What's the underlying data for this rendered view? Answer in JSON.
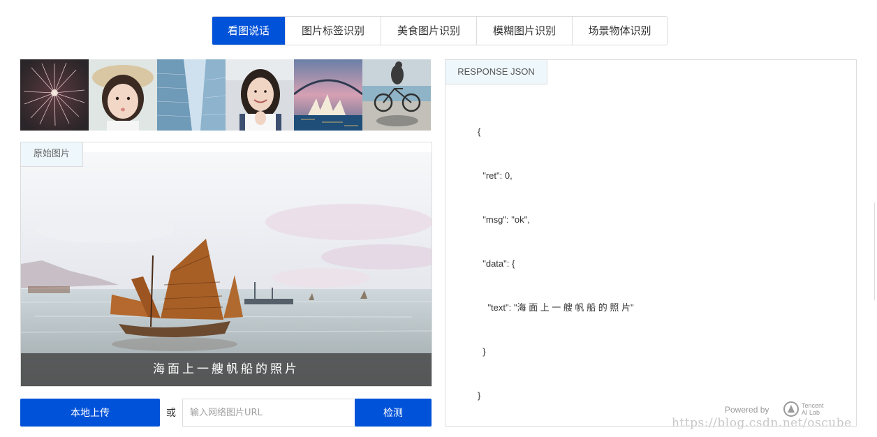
{
  "tabs": [
    {
      "label": "看图说话",
      "active": true
    },
    {
      "label": "图片标签识别",
      "active": false
    },
    {
      "label": "美食图片识别",
      "active": false
    },
    {
      "label": "模糊图片识别",
      "active": false
    },
    {
      "label": "场景物体识别",
      "active": false
    }
  ],
  "thumbnails": [
    {
      "icon": "fireworks-thumbnail"
    },
    {
      "icon": "girl-with-hat-thumbnail"
    },
    {
      "icon": "skyscrapers-thumbnail"
    },
    {
      "icon": "smiling-woman-thumbnail"
    },
    {
      "icon": "sydney-opera-house-thumbnail"
    },
    {
      "icon": "cyclist-beach-thumbnail"
    }
  ],
  "original_panel": {
    "tab_label": "原始图片",
    "caption": "海面上一艘帆船的照片"
  },
  "controls": {
    "upload_label": "本地上传",
    "or_label": "或",
    "url_placeholder": "输入网络图片URL",
    "detect_label": "检测"
  },
  "json_panel": {
    "tab_label": "RESPONSE JSON",
    "lines": [
      "{",
      "  \"ret\": 0,",
      "  \"msg\": \"ok\",",
      "  \"data\": {",
      "    \"text\": \"海 面 上 一 艘 帆 船 的 照 片\"",
      "  }",
      "}"
    ],
    "powered_by": "Powered by",
    "brand_line1": "Tencent",
    "brand_line2": "AI Lab"
  },
  "watermark": "https://blog.csdn.net/oscube",
  "colors": {
    "accent": "#0052d9",
    "tab_bg": "#eef7fc",
    "border": "#dcdcdc"
  }
}
